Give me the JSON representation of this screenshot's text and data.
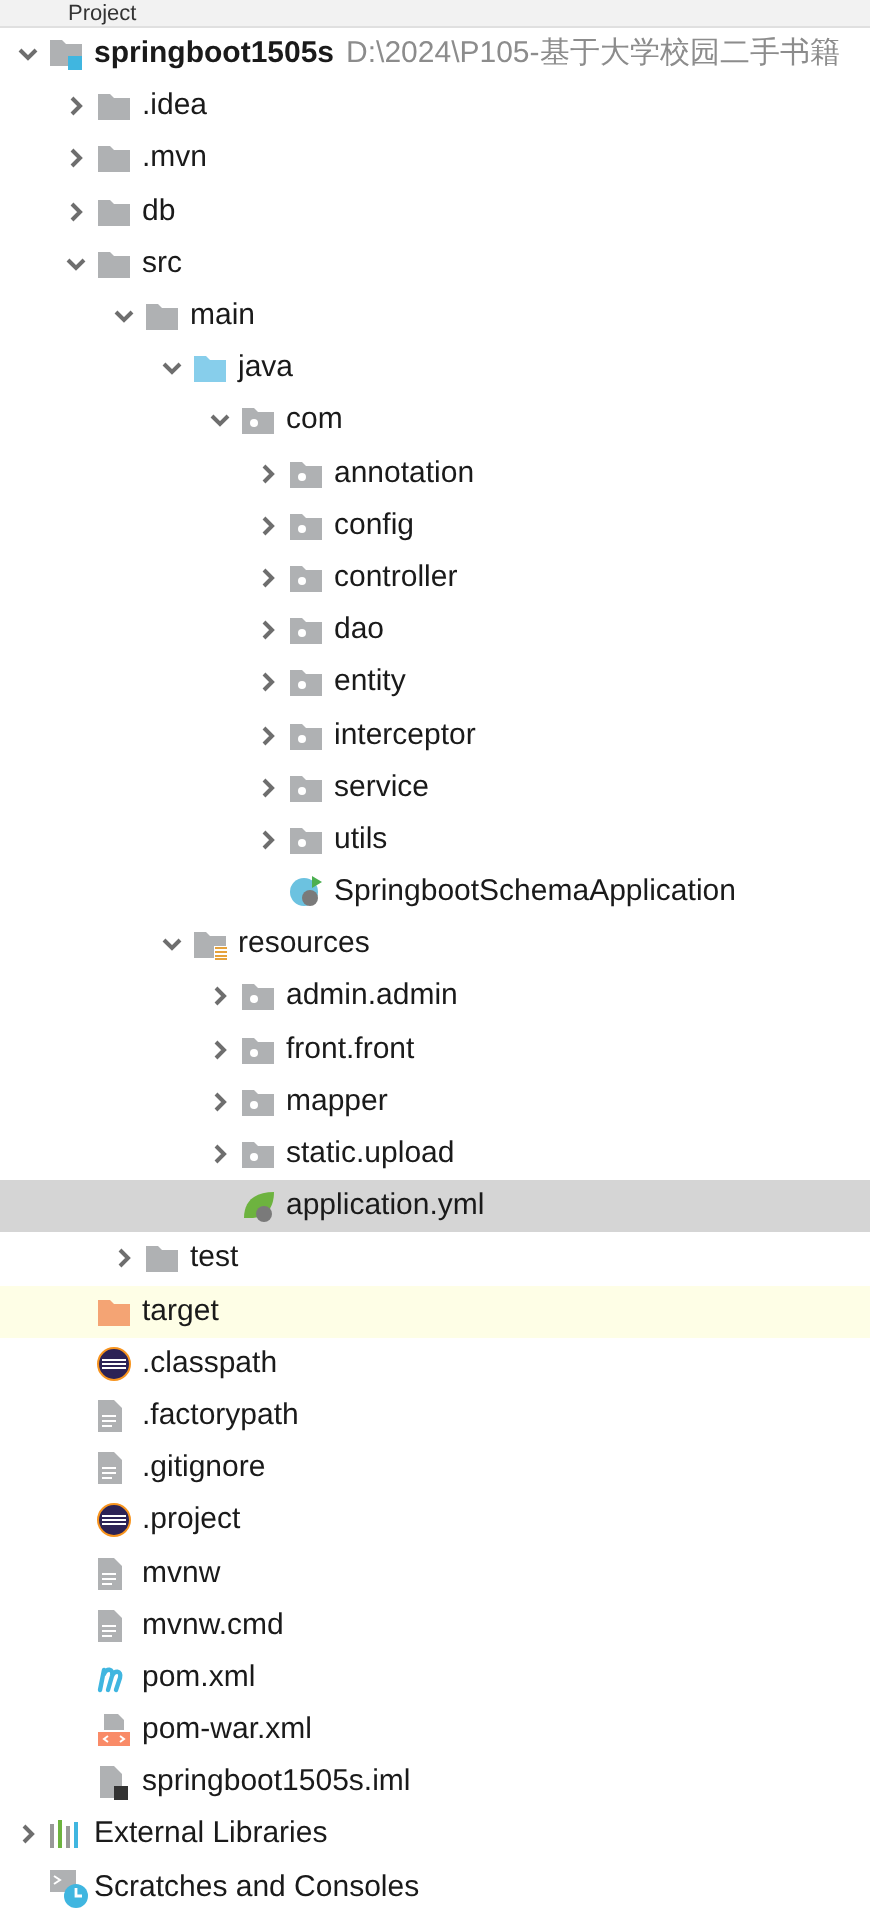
{
  "panel": {
    "title": "Project"
  },
  "tree": [
    {
      "label": "springboot1505s",
      "path": "D:\\2024\\P105-基于大学校园二手书籍",
      "kind": "module",
      "expanded": true,
      "selected": false,
      "children": [
        {
          "label": ".idea",
          "kind": "folder",
          "expanded": false,
          "selected": false
        },
        {
          "label": ".mvn",
          "kind": "folder",
          "expanded": false,
          "selected": false
        },
        {
          "label": "db",
          "kind": "folder",
          "expanded": false,
          "selected": false
        },
        {
          "label": "src",
          "kind": "folder",
          "expanded": true,
          "selected": false,
          "children": [
            {
              "label": "main",
              "kind": "folder",
              "expanded": true,
              "selected": false,
              "children": [
                {
                  "label": "java",
                  "kind": "source",
                  "expanded": true,
                  "selected": false,
                  "children": [
                    {
                      "label": "com",
                      "kind": "package",
                      "expanded": true,
                      "selected": false,
                      "children": [
                        {
                          "label": "annotation",
                          "kind": "package",
                          "expanded": false,
                          "selected": false
                        },
                        {
                          "label": "config",
                          "kind": "package",
                          "expanded": false,
                          "selected": false
                        },
                        {
                          "label": "controller",
                          "kind": "package",
                          "expanded": false,
                          "selected": false
                        },
                        {
                          "label": "dao",
                          "kind": "package",
                          "expanded": false,
                          "selected": false
                        },
                        {
                          "label": "entity",
                          "kind": "package",
                          "expanded": false,
                          "selected": false
                        },
                        {
                          "label": "interceptor",
                          "kind": "package",
                          "expanded": false,
                          "selected": false
                        },
                        {
                          "label": "service",
                          "kind": "package",
                          "expanded": false,
                          "selected": false
                        },
                        {
                          "label": "utils",
                          "kind": "package",
                          "expanded": false,
                          "selected": false
                        },
                        {
                          "label": "SpringbootSchemaApplication",
                          "kind": "app",
                          "selected": false
                        }
                      ]
                    }
                  ]
                },
                {
                  "label": "resources",
                  "kind": "resources",
                  "expanded": true,
                  "selected": false,
                  "children": [
                    {
                      "label": "admin.admin",
                      "kind": "package",
                      "expanded": false,
                      "selected": false
                    },
                    {
                      "label": "front.front",
                      "kind": "package",
                      "expanded": false,
                      "selected": false
                    },
                    {
                      "label": "mapper",
                      "kind": "package",
                      "expanded": false,
                      "selected": false
                    },
                    {
                      "label": "static.upload",
                      "kind": "package",
                      "expanded": false,
                      "selected": false
                    },
                    {
                      "label": "application.yml",
                      "kind": "spring",
                      "selected": true
                    }
                  ]
                }
              ]
            },
            {
              "label": "test",
              "kind": "folder",
              "expanded": false,
              "selected": false
            }
          ]
        },
        {
          "label": "target",
          "kind": "excluded",
          "selected": false
        },
        {
          "label": ".classpath",
          "kind": "eclipse",
          "selected": false
        },
        {
          "label": ".factorypath",
          "kind": "text",
          "selected": false
        },
        {
          "label": ".gitignore",
          "kind": "text",
          "selected": false
        },
        {
          "label": ".project",
          "kind": "eclipse",
          "selected": false
        },
        {
          "label": "mvnw",
          "kind": "text",
          "selected": false
        },
        {
          "label": "mvnw.cmd",
          "kind": "text",
          "selected": false
        },
        {
          "label": "pom.xml",
          "kind": "maven",
          "selected": false
        },
        {
          "label": "pom-war.xml",
          "kind": "xml",
          "selected": false
        },
        {
          "label": "springboot1505s.iml",
          "kind": "iml",
          "selected": false
        }
      ]
    },
    {
      "label": "External Libraries",
      "kind": "libraries",
      "expanded": false,
      "selected": false
    },
    {
      "label": "Scratches and Consoles",
      "kind": "scratches",
      "selected": false
    }
  ]
}
